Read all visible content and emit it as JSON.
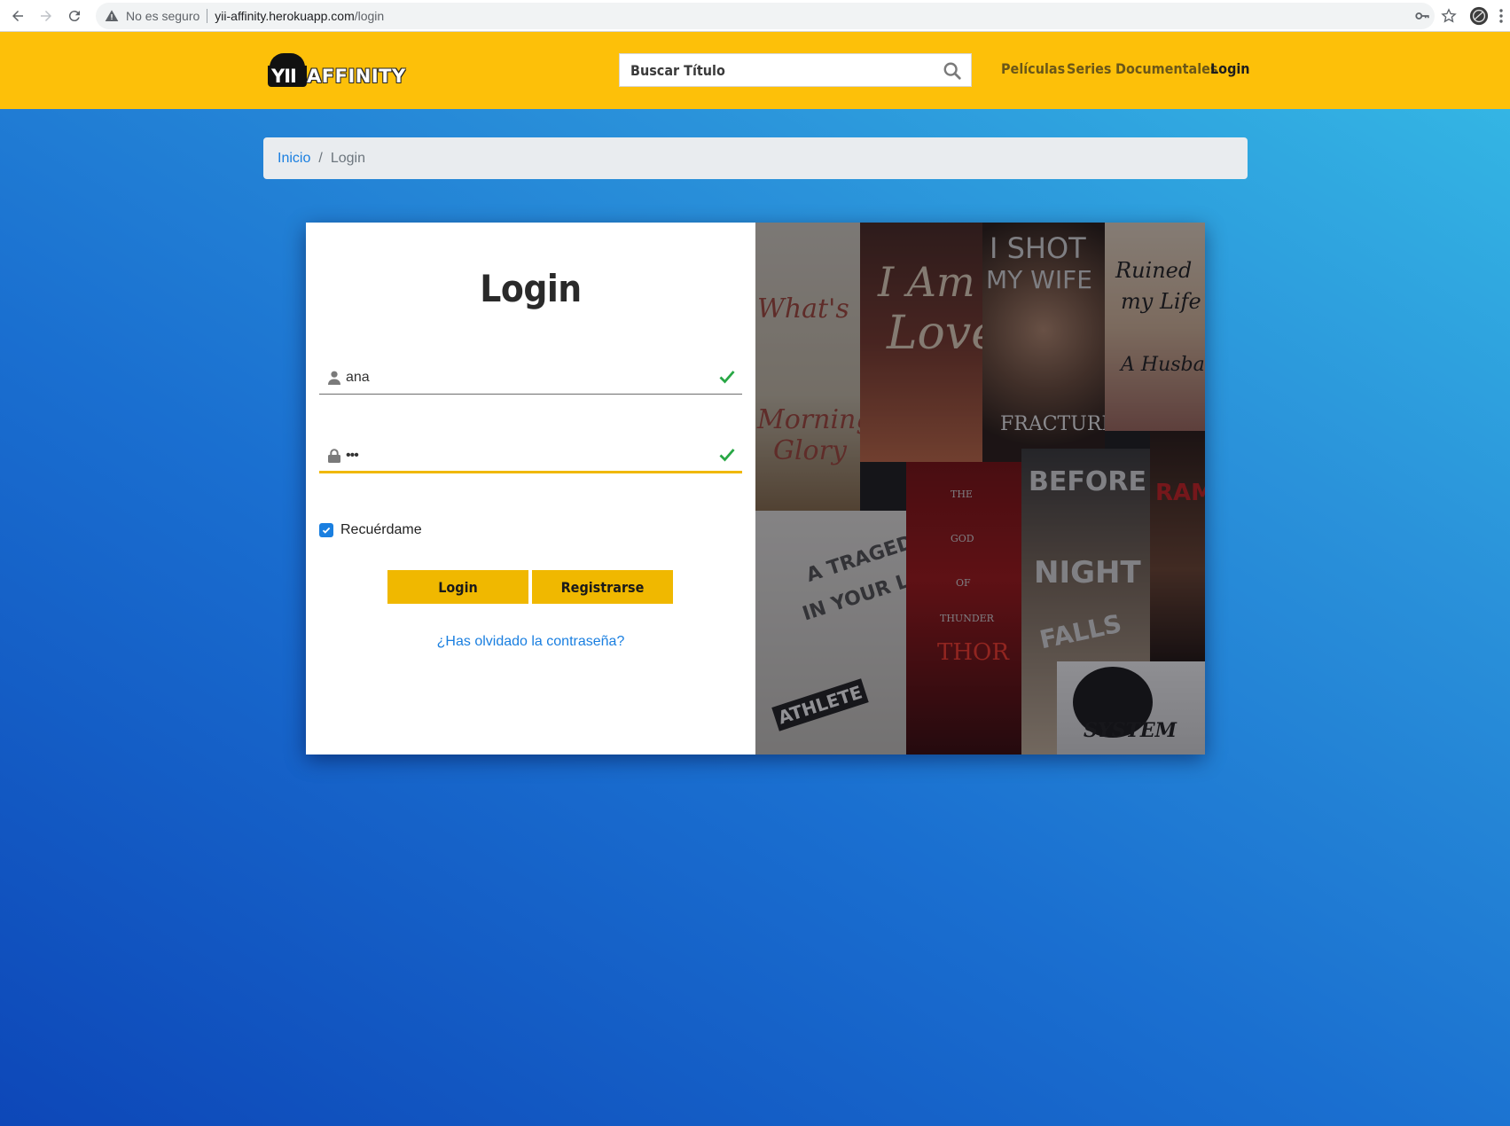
{
  "browser": {
    "security_label": "No es seguro",
    "url_host": "yii-affinity.herokuapp.com",
    "url_path": "/login"
  },
  "header": {
    "logo_yii": "YII",
    "logo_rest": "AFFINITY",
    "search_placeholder": "Buscar Título",
    "nav": [
      "Películas",
      "Series",
      "Documentales",
      "Login"
    ]
  },
  "breadcrumb": {
    "home": "Inicio",
    "separator": "/",
    "current": "Login"
  },
  "login": {
    "title": "Login",
    "username_value": "ana",
    "password_value": "•••",
    "remember_label": "Recuérdame",
    "remember_checked": true,
    "login_button": "Login",
    "register_button": "Registrarse",
    "forgot_link": "¿Has olvidado la contraseña?"
  },
  "posters": {
    "p1": [
      "What's",
      "Morning",
      "Glory"
    ],
    "p2": [
      "I Am",
      "Love"
    ],
    "p3": [
      "I SHOT",
      "MY WIFE",
      "FRACTURE"
    ],
    "p4": [
      "Ruined",
      "my Life",
      "A Husband"
    ],
    "p5": [
      "A TRAGEDY",
      "IN YOUR LIFE",
      "ATHLETE"
    ],
    "p6": [
      "THE",
      "GOD",
      "OF",
      "THUNDER",
      "THOR"
    ],
    "p7": [
      "BEFORE",
      "NIGHT",
      "FALLS"
    ],
    "p8": [
      "RAMB"
    ],
    "p9": [
      "SYSTEM"
    ]
  },
  "colors": {
    "header_bg": "#fdc009",
    "accent_button": "#f0b800",
    "link": "#1a7fe0",
    "check_green": "#28a745"
  }
}
